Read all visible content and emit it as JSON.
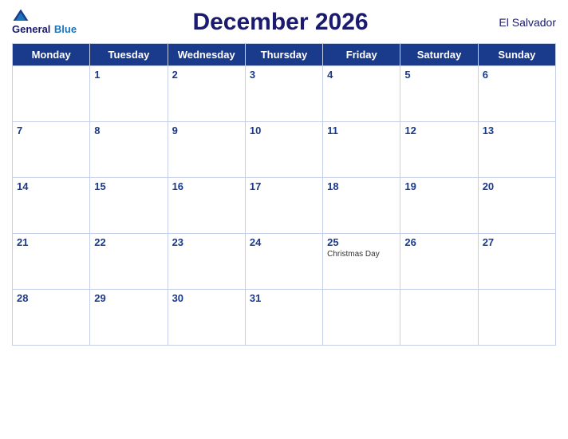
{
  "header": {
    "logo_general": "General",
    "logo_blue": "Blue",
    "title": "December 2026",
    "country": "El Salvador"
  },
  "weekdays": [
    "Monday",
    "Tuesday",
    "Wednesday",
    "Thursday",
    "Friday",
    "Saturday",
    "Sunday"
  ],
  "weeks": [
    [
      {
        "day": "",
        "empty": true
      },
      {
        "day": "1"
      },
      {
        "day": "2"
      },
      {
        "day": "3"
      },
      {
        "day": "4"
      },
      {
        "day": "5"
      },
      {
        "day": "6"
      }
    ],
    [
      {
        "day": "7"
      },
      {
        "day": "8"
      },
      {
        "day": "9"
      },
      {
        "day": "10"
      },
      {
        "day": "11"
      },
      {
        "day": "12"
      },
      {
        "day": "13"
      }
    ],
    [
      {
        "day": "14"
      },
      {
        "day": "15"
      },
      {
        "day": "16"
      },
      {
        "day": "17"
      },
      {
        "day": "18"
      },
      {
        "day": "19"
      },
      {
        "day": "20"
      }
    ],
    [
      {
        "day": "21"
      },
      {
        "day": "22"
      },
      {
        "day": "23"
      },
      {
        "day": "24"
      },
      {
        "day": "25",
        "event": "Christmas Day"
      },
      {
        "day": "26"
      },
      {
        "day": "27"
      }
    ],
    [
      {
        "day": "28"
      },
      {
        "day": "29"
      },
      {
        "day": "30"
      },
      {
        "day": "31"
      },
      {
        "day": "",
        "empty": true
      },
      {
        "day": "",
        "empty": true
      },
      {
        "day": "",
        "empty": true
      }
    ]
  ]
}
